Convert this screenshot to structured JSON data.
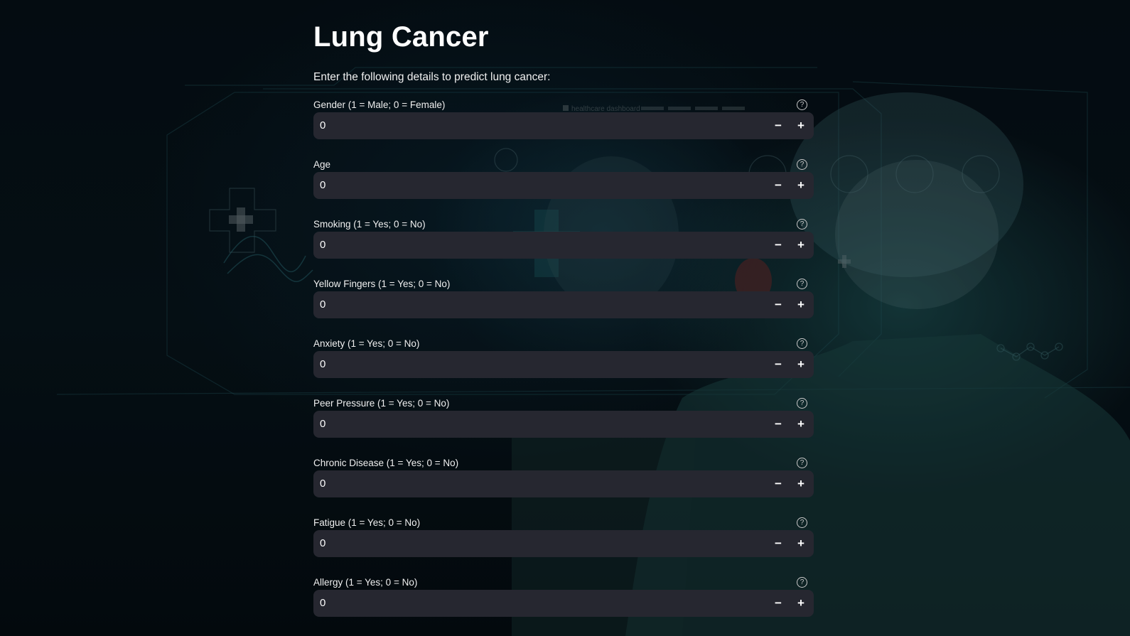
{
  "page": {
    "title": "Lung Cancer",
    "subtitle": "Enter the following details to predict lung cancer:"
  },
  "fields": [
    {
      "label": "Gender (1 = Male; 0 = Female)",
      "value": "0"
    },
    {
      "label": "Age",
      "value": "0"
    },
    {
      "label": "Smoking (1 = Yes; 0 = No)",
      "value": "0"
    },
    {
      "label": "Yellow Fingers (1 = Yes; 0 = No)",
      "value": "0"
    },
    {
      "label": "Anxiety (1 = Yes; 0 = No)",
      "value": "0"
    },
    {
      "label": "Peer Pressure (1 = Yes; 0 = No)",
      "value": "0"
    },
    {
      "label": "Chronic Disease (1 = Yes; 0 = No)",
      "value": "0"
    },
    {
      "label": "Fatigue (1 = Yes; 0 = No)",
      "value": "0"
    },
    {
      "label": "Allergy (1 = Yes; 0 = No)",
      "value": "0"
    }
  ],
  "controls": {
    "minus_glyph": "−",
    "plus_glyph": "+",
    "help_glyph": "?"
  },
  "background": {
    "watermark_text": "healthcare dashboard"
  },
  "colors": {
    "input_background": "#262730",
    "page_background": "#050b10",
    "accent_teal": "#2a7f86"
  }
}
